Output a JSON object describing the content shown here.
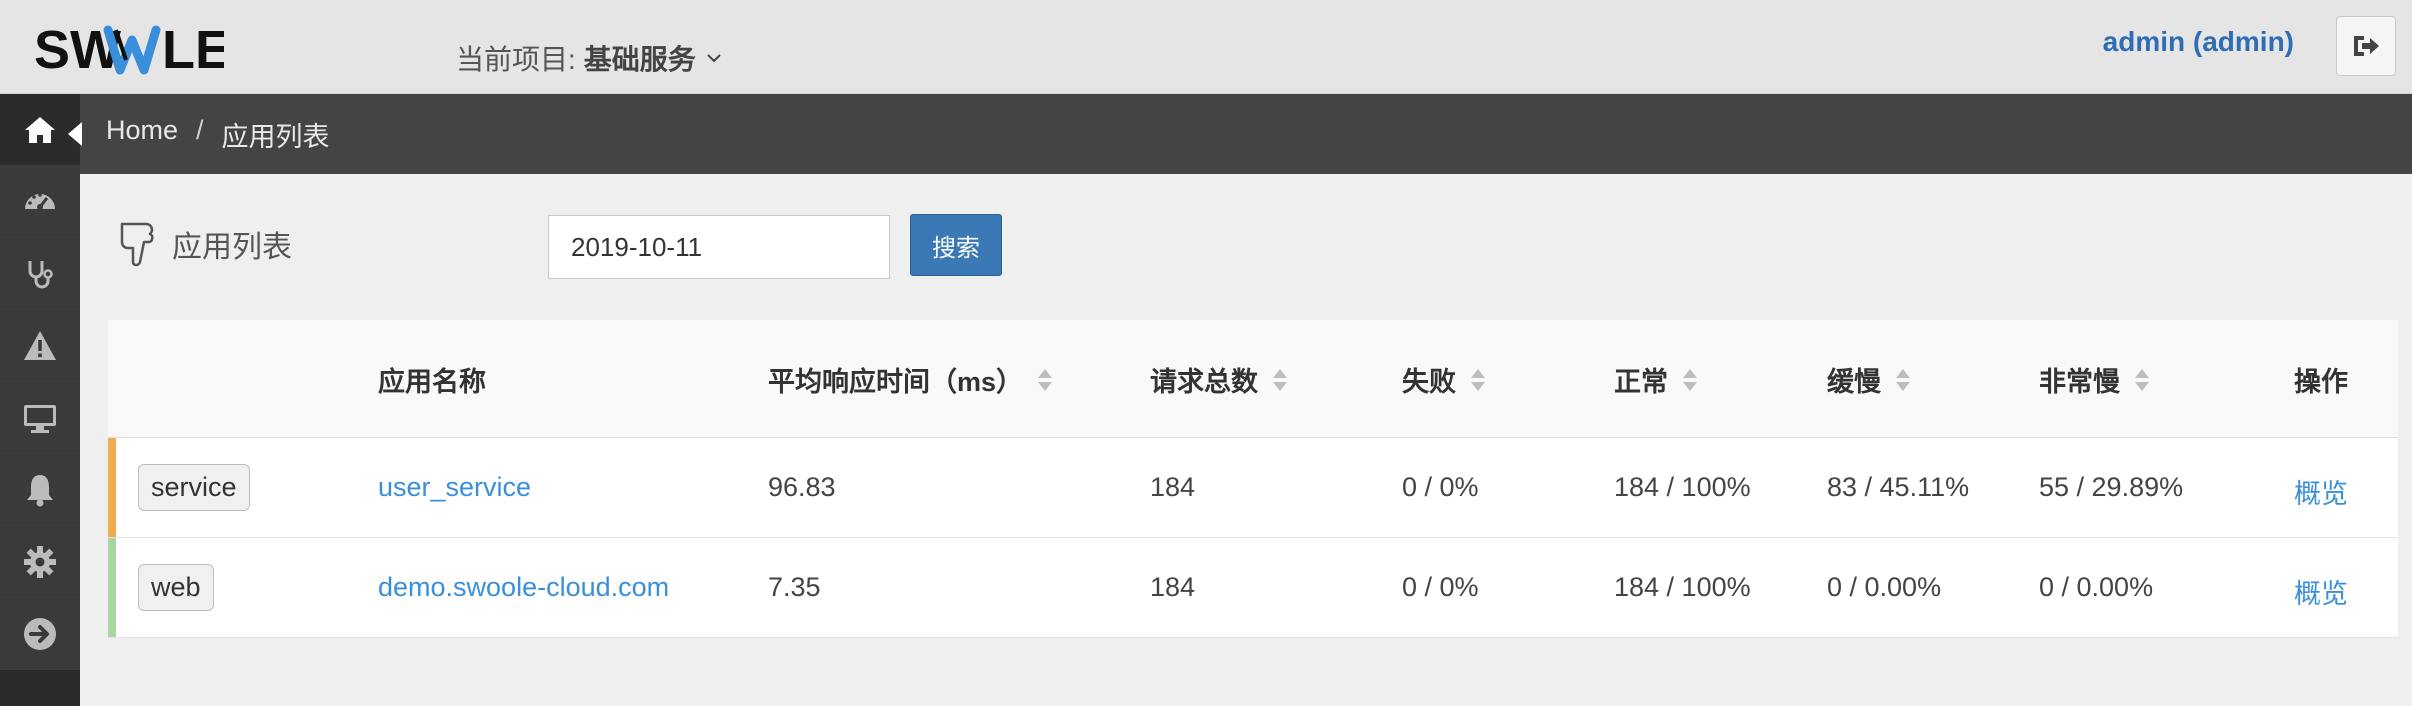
{
  "header": {
    "logo_text": "SWOOLE",
    "project_label": "当前项目:",
    "project_value": "基础服务",
    "user": "admin (admin)"
  },
  "sidebar": {
    "items": [
      {
        "icon": "home-icon"
      },
      {
        "icon": "dashboard-icon"
      },
      {
        "icon": "stethoscope-icon"
      },
      {
        "icon": "warning-icon"
      },
      {
        "icon": "monitor-icon"
      },
      {
        "icon": "bell-icon"
      },
      {
        "icon": "gear-icon"
      },
      {
        "icon": "arrow-right-circle-icon"
      }
    ]
  },
  "breadcrumb": {
    "home": "Home",
    "separator": "/",
    "current": "应用列表"
  },
  "page": {
    "title": "应用列表",
    "date_value": "2019-10-11",
    "search_label": "搜索"
  },
  "table": {
    "headers": {
      "name": "应用名称",
      "avg_time": "平均响应时间（ms）",
      "total": "请求总数",
      "fail": "失败",
      "normal": "正常",
      "slow": "缓慢",
      "very_slow": "非常慢",
      "action": "操作"
    },
    "rows": [
      {
        "tag": "service",
        "stripe_color": "#f0ad4e",
        "name": "user_service",
        "avg_time": "96.83",
        "total": "184",
        "fail": "0 / 0%",
        "normal": "184 / 100%",
        "slow": "83 / 45.11%",
        "very_slow": "55 / 29.89%",
        "action": "概览"
      },
      {
        "tag": "web",
        "stripe_color": "#a8d5a2",
        "name": "demo.swoole-cloud.com",
        "avg_time": "7.35",
        "total": "184",
        "fail": "0 / 0%",
        "normal": "184 / 100%",
        "slow": "0 / 0.00%",
        "very_slow": "0 / 0.00%",
        "action": "概览"
      }
    ]
  },
  "colors": {
    "accent": "#3b79b6",
    "link": "#3a8fdb",
    "user": "#2f6db5",
    "sidebar": "#2b2b2b",
    "breadcrumb_bar": "#444444"
  }
}
